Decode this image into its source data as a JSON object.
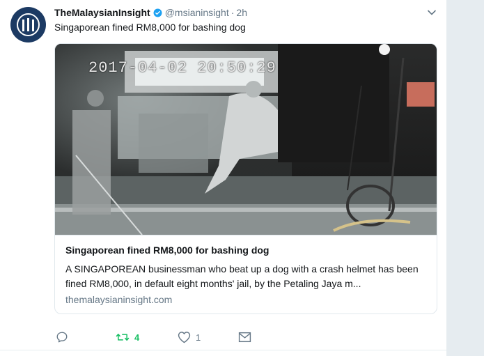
{
  "tweet": {
    "display_name": "TheMalaysianInsight",
    "handle": "@msianinsight",
    "separator": "·",
    "time": "2h",
    "text": "Singaporean fined RM8,000 for bashing dog"
  },
  "card": {
    "image_timestamp": "2017-04-02 20:50:29",
    "title": "Singaporean fined RM8,000 for bashing dog",
    "description": "A SINGAPOREAN businessman who beat up a dog with a crash helmet has been fined RM8,000, in default eight months' jail, by the Petaling Jaya m...",
    "domain": "themalaysianinsight.com"
  },
  "actions": {
    "reply_count": "",
    "retweet_count": "4",
    "like_count": "1"
  },
  "colors": {
    "text": "#14171a",
    "secondary": "#657786",
    "verified": "#1da1f2",
    "retweet_active": "#17bf63",
    "avatar_bg": "#1c3a63",
    "side_panel": "#e6ecf0"
  },
  "icons": [
    "verified-badge-icon",
    "chevron-down-icon",
    "reply-icon",
    "retweet-icon",
    "like-icon",
    "direct-message-icon"
  ]
}
